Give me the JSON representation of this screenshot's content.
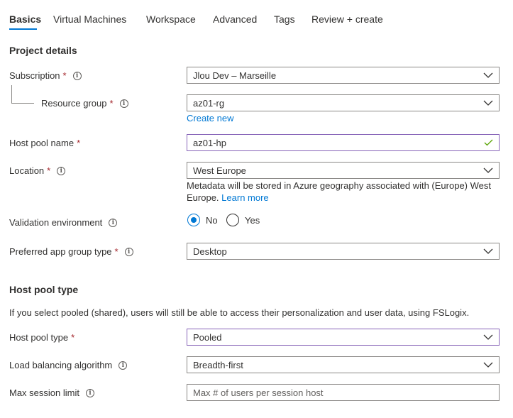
{
  "tabs": [
    {
      "label": "Basics",
      "active": true
    },
    {
      "label": "Virtual Machines"
    },
    {
      "label": "Workspace"
    },
    {
      "label": "Advanced"
    },
    {
      "label": "Tags"
    },
    {
      "label": "Review + create"
    }
  ],
  "project_details": {
    "title": "Project details",
    "subscription": {
      "label": "Subscription",
      "required": "*",
      "value": "Jlou Dev – Marseille"
    },
    "resource_group": {
      "label": "Resource group",
      "required": "*",
      "value": "az01-rg",
      "create_new": "Create new"
    },
    "host_pool_name": {
      "label": "Host pool name",
      "required": "*",
      "value": "az01-hp"
    },
    "location": {
      "label": "Location",
      "required": "*",
      "value": "West Europe",
      "hint": "Metadata will be stored in Azure geography associated with (Europe) West Europe.",
      "learn_more": "Learn more"
    },
    "validation_environment": {
      "label": "Validation environment",
      "options": [
        "No",
        "Yes"
      ],
      "selected": "No"
    },
    "preferred_app_group_type": {
      "label": "Preferred app group type",
      "required": "*",
      "value": "Desktop"
    }
  },
  "host_pool_type_section": {
    "title": "Host pool type",
    "description": "If you select pooled (shared), users will still be able to access their personalization and user data, using FSLogix.",
    "host_pool_type": {
      "label": "Host pool type",
      "required": "*",
      "value": "Pooled"
    },
    "load_balancing": {
      "label": "Load balancing algorithm",
      "value": "Breadth-first"
    },
    "max_session_limit": {
      "label": "Max session limit",
      "placeholder": "Max # of users per session host"
    }
  },
  "icons": {
    "info": "info-icon",
    "chevron": "chevron-down-icon",
    "valid": "checkmark-icon"
  },
  "colors": {
    "accent": "#0078d4",
    "required": "#a4262c",
    "focus_border": "#8764b8",
    "valid": "#57a300"
  }
}
